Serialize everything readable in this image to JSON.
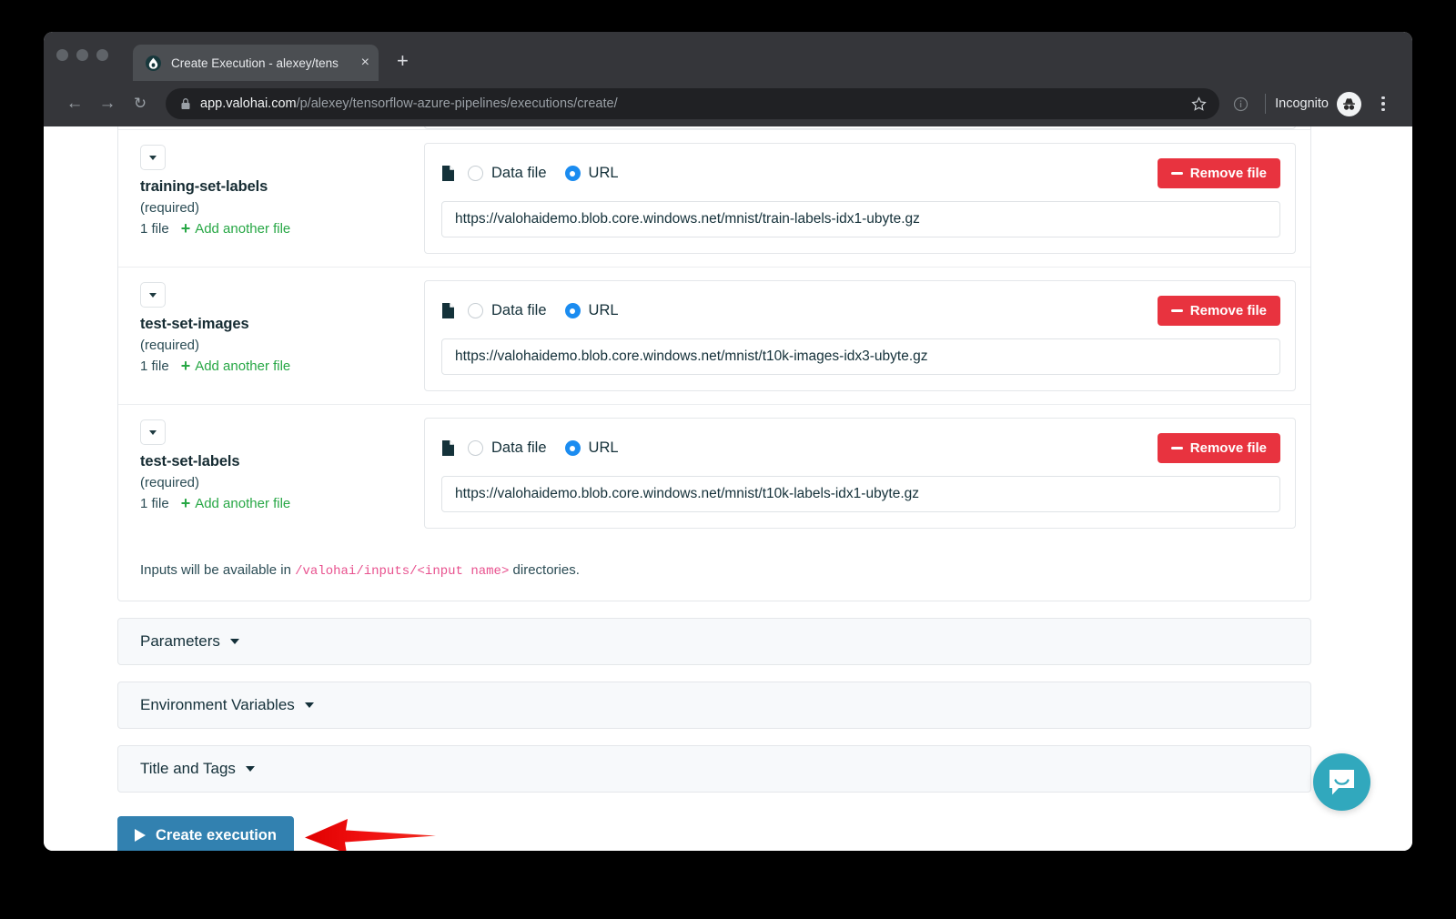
{
  "browser": {
    "tab": {
      "title": "Create Execution - alexey/tens",
      "favicon_name": "valohai-droplet-icon",
      "close_label": "×"
    },
    "new_tab_label": "+",
    "nav": {
      "back_label": "←",
      "forward_label": "→",
      "reload_label": "↻"
    },
    "omnibox": {
      "lock_icon": "lock-icon",
      "url_host": "app.valohai.com",
      "url_path": "/p/alexey/tensorflow-azure-pipelines/executions/create/",
      "star_icon": "star-icon",
      "info_icon": "info-circle-icon"
    },
    "profile": {
      "incognito_label": "Incognito",
      "avatar_icon": "incognito-avatar-icon"
    },
    "menu_icon": "kebab-menu-icon"
  },
  "page": {
    "inputs": [
      {
        "name": "training-set-labels",
        "required_label": "(required)",
        "file_count_label": "1 file",
        "add_file_label": "Add another file",
        "source_options": [
          {
            "label": "Data file",
            "selected": false
          },
          {
            "label": "URL",
            "selected": true
          }
        ],
        "remove_label": "Remove file",
        "url_value": "https://valohaidemo.blob.core.windows.net/mnist/train-labels-idx1-ubyte.gz"
      },
      {
        "name": "test-set-images",
        "required_label": "(required)",
        "file_count_label": "1 file",
        "add_file_label": "Add another file",
        "source_options": [
          {
            "label": "Data file",
            "selected": false
          },
          {
            "label": "URL",
            "selected": true
          }
        ],
        "remove_label": "Remove file",
        "url_value": "https://valohaidemo.blob.core.windows.net/mnist/t10k-images-idx3-ubyte.gz"
      },
      {
        "name": "test-set-labels",
        "required_label": "(required)",
        "file_count_label": "1 file",
        "add_file_label": "Add another file",
        "source_options": [
          {
            "label": "Data file",
            "selected": false
          },
          {
            "label": "URL",
            "selected": true
          }
        ],
        "remove_label": "Remove file",
        "url_value": "https://valohaidemo.blob.core.windows.net/mnist/t10k-labels-idx1-ubyte.gz"
      }
    ],
    "inputs_note": {
      "prefix": "Inputs will be available in ",
      "code": "/valohai/inputs/<input name>",
      "suffix": " directories."
    },
    "sections": [
      {
        "label": "Parameters"
      },
      {
        "label": "Environment Variables"
      },
      {
        "label": "Title and Tags"
      }
    ],
    "create_button": {
      "label": "Create execution",
      "icon": "play-icon"
    },
    "annotation": {
      "arrow_icon": "red-arrow-pointing-left",
      "color": "#ee1111"
    },
    "intercom": {
      "icon": "chat-bubble-icon",
      "color": "#31a8bd"
    }
  },
  "colors": {
    "accent_blue": "#1b8cf0",
    "danger_red": "#e8333f",
    "primary_button": "#3281b0",
    "link_green": "#27a745",
    "code_pink": "#e8518e"
  }
}
